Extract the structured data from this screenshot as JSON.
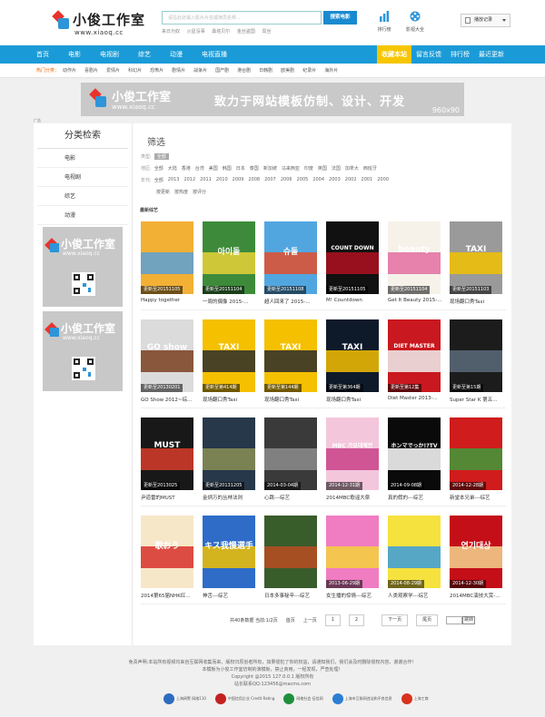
{
  "site": {
    "name": "小俊工作室",
    "url": "www.xiaoq.cc"
  },
  "search": {
    "placeholder": "请在此处输入影片片名或演员名称...",
    "button": "搜索电影",
    "hot": [
      "来日为奴",
      "火星没事",
      "桑塔贝尔",
      "金丝盗国",
      "屌丝"
    ]
  },
  "top_icons": [
    {
      "label": "排行榜",
      "icon": "bar-chart-icon",
      "color": "#2d95d8"
    },
    {
      "label": "影视大全",
      "icon": "film-reel-icon",
      "color": "#2d95d8"
    }
  ],
  "history": {
    "label": "播放记录"
  },
  "nav": {
    "items": [
      "首页",
      "电影",
      "电视剧",
      "综艺",
      "动漫",
      "电视直播"
    ],
    "right": [
      "收藏本站",
      "留言反馈",
      "排行榜",
      "最近更新"
    ],
    "accent": "#1a9bd7",
    "feature_color": "#f6c600"
  },
  "hot_genres": {
    "label": "热门分类：",
    "items": [
      "动作片",
      "喜剧片",
      "爱情片",
      "科幻片",
      "恐怖片",
      "剧情片",
      "战争片",
      "国产剧",
      "港台剧",
      "日韩剧",
      "欧美剧",
      "纪录片",
      "海外片"
    ]
  },
  "banner": {
    "slogan": "致力于网站模板仿制、设计、开发",
    "size": "960x90"
  },
  "ad_label": "广告",
  "sidebar": {
    "title": "分类检索",
    "items": [
      "电影",
      "电视剧",
      "综艺",
      "动漫"
    ]
  },
  "filter": {
    "title": "筛选",
    "type": {
      "label": "类型:",
      "values": [
        "全部"
      ]
    },
    "region": {
      "label": "地区:",
      "values": [
        "全部",
        "大陆",
        "香港",
        "台湾",
        "美国",
        "韩国",
        "日本",
        "泰国",
        "新加坡",
        "马来西亚",
        "印度",
        "英国",
        "法国",
        "加拿大",
        "西班牙"
      ]
    },
    "year": {
      "label": "年代:",
      "values": [
        "全部",
        "2013",
        "2012",
        "2011",
        "2010",
        "2009",
        "2008",
        "2007",
        "2006",
        "2005",
        "2004",
        "2003",
        "2002",
        "2001",
        "2000"
      ]
    },
    "sort": {
      "values": [
        "按更新",
        "按热度",
        "按评分"
      ]
    }
  },
  "section_title": "最新综艺",
  "items": [
    {
      "title": "Happy together",
      "ep": "更新至20151105",
      "c1": "#f2b035",
      "c2": "#5aa0d6",
      "txt": ""
    },
    {
      "title": "一周的偶像 2015-...",
      "ep": "更新至20151104",
      "c1": "#3d8b3a",
      "c2": "#e8d23a",
      "txt": "아이돌"
    },
    {
      "title": "超人回来了 2015-...",
      "ep": "更新至20151108",
      "c1": "#52a6e0",
      "c2": "#e24f2c",
      "txt": "슈돌"
    },
    {
      "title": "M! Countdown",
      "ep": "更新至20151105",
      "c1": "#111111",
      "c2": "#b01020",
      "txt": "COUNT DOWN"
    },
    {
      "title": "Get It Beauty 2015-...",
      "ep": "更新至20151104",
      "c1": "#f6f2ea",
      "c2": "#e36ea1",
      "txt": "beauty"
    },
    {
      "title": "现场翻口秀Taxi",
      "ep": "更新至20151103",
      "c1": "#9a9a9a",
      "c2": "#f2c200",
      "txt": "TAXI"
    },
    {
      "title": "GO Show 2012~综...",
      "ep": "更新至20130201",
      "c1": "#dbdbdb",
      "c2": "#7a3f1e",
      "txt": "GO show"
    },
    {
      "title": "现场翻口秀Taxi",
      "ep": "更新至第414期",
      "c1": "#f5c000",
      "c2": "#2b2b2b",
      "txt": "TAXI"
    },
    {
      "title": "现场翻口秀Taxi",
      "ep": "更新至第144期",
      "c1": "#f5c000",
      "c2": "#2b2b2b",
      "txt": "TAXI"
    },
    {
      "title": "现场翻口秀Taxi",
      "ep": "更新至第364期",
      "c1": "#0e1a2a",
      "c2": "#f5c000",
      "txt": "TAXI"
    },
    {
      "title": "Diet Master 2013-...",
      "ep": "更新至第12集",
      "c1": "#c9181f",
      "c2": "#f0f0f0",
      "txt": "DIET MASTER"
    },
    {
      "title": "Super Star K 第五...",
      "ep": "更新至第15期",
      "c1": "#1c1c1c",
      "c2": "#5b6b7a",
      "txt": ""
    },
    {
      "title": "尹道雷的MUST",
      "ep": "更新至2013025",
      "c1": "#181818",
      "c2": "#d93c2a",
      "txt": "MUST"
    },
    {
      "title": "金炳万的丛林法则",
      "ep": "更新至20131205",
      "c1": "#27384a",
      "c2": "#8a8f56",
      "txt": ""
    },
    {
      "title": "心跳---综艺",
      "ep": "2014-03-04期",
      "c1": "#3a3a3a",
      "c2": "#8d8d8d",
      "txt": ""
    },
    {
      "title": "2014MBC歌谣大祭",
      "ep": "2014-12-31期",
      "c1": "#f4c6dc",
      "c2": "#c84187",
      "txt": "MBC 가요대제전"
    },
    {
      "title": "真的假的---综艺",
      "ep": "2014-09-08期",
      "c1": "#0a0a0a",
      "c2": "#ffffff",
      "txt": "ホンマでっか!?TV"
    },
    {
      "title": "新堂本兄弟---综艺",
      "ep": "2014-12-28期",
      "c1": "#d01c1c",
      "c2": "#3e9b3a",
      "txt": ""
    },
    {
      "title": "2014第65届NHK红...",
      "ep": "",
      "c1": "#f6e7c8",
      "c2": "#d8302a",
      "txt": "歌おう"
    },
    {
      "title": "神舌---综艺",
      "ep": "",
      "c1": "#2e6cc8",
      "c2": "#f0c000",
      "txt": "キス我慢選手"
    },
    {
      "title": "日本多事秘辛---综艺",
      "ep": "",
      "c1": "#395c2b",
      "c2": "#b94c22",
      "txt": ""
    },
    {
      "title": "女生播的惊情---综艺",
      "ep": "2013-06-29期",
      "c1": "#f07cc2",
      "c2": "#f5d23b",
      "txt": ""
    },
    {
      "title": "人类观察学---综艺",
      "ep": "2014-08-29期",
      "c1": "#f6e23e",
      "c2": "#3a9cde",
      "txt": ""
    },
    {
      "title": "2014MBC演技大赏-...",
      "ep": "2014-12-30期",
      "c1": "#c40e18",
      "c2": "#f3d38f",
      "txt": "연기대상"
    }
  ],
  "pager": {
    "summary": "共40条数据 当前:1/2页",
    "first": "首页",
    "prev": "上一页",
    "pages": [
      "1",
      "2"
    ],
    "next": "下一页",
    "last": "尾页",
    "go": "跳转"
  },
  "footer": {
    "lines": [
      "免责声明:本站所有视频均来自互联网收集而来，版权归原创者所有，如果侵犯了你的权益，请通知我们，我们会及时删除侵权内容，谢谢合作！",
      "本模板为小俊工作室仿制的演模板，禁止商用，一经发现，严查处理！",
      "Copyright @2015 127.0.0.1 版权所有",
      "站长联系QQ:123456@macms.com"
    ],
    "badges": [
      {
        "label": "上海网警 网络110",
        "color": "#2d6cc0"
      },
      {
        "label": "中国信用企业 Credit Rating",
        "color": "#c42020"
      },
      {
        "label": "网络社会 征信网",
        "color": "#1f8f3c"
      },
      {
        "label": "上海市互联网违法和不良信息",
        "color": "#2a7fd3"
      },
      {
        "label": "上海工商",
        "color": "#d8321e"
      }
    ]
  }
}
